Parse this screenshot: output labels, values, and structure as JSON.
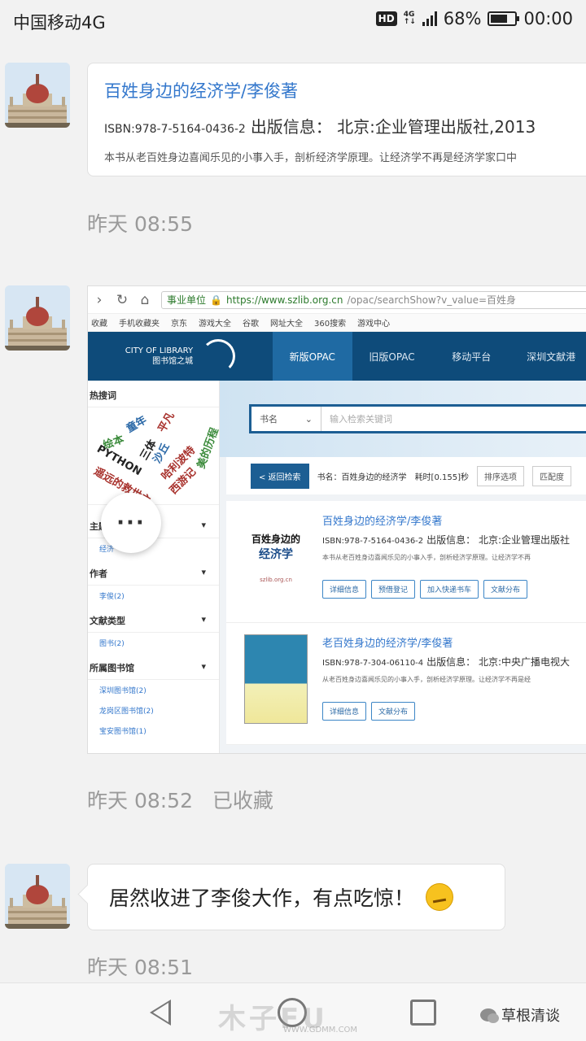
{
  "status_bar": {
    "carrier": "中国移动4G",
    "hd": "HD",
    "network_type": "4G",
    "battery": "68%",
    "clock": "00:00"
  },
  "messages": [
    {
      "card": {
        "title": "百姓身边的经济学/李俊著",
        "isbn": "ISBN:978-7-5164-0436-2",
        "publish": "出版信息： 北京:企业管理出版社,2013",
        "desc": "本书从老百姓身边喜闻乐见的小事入手，剖析经济学原理。让经济学不再是经济学家口中"
      },
      "time": "昨天 08:55"
    },
    {
      "time": "昨天 08:52",
      "status": "已收藏"
    },
    {
      "text": "居然收进了李俊大作，有点吃惊！",
      "time": "昨天 08:51"
    }
  ],
  "screenshot": {
    "url_prefix": "事业单位",
    "url": "https://www.szlib.org.cn",
    "url_rest": "/opac/searchShow?v_value=百姓身",
    "bookmarks": [
      "收藏",
      "手机收藏夹",
      "京东",
      "游戏大全",
      "谷歌",
      "网址大全",
      "360搜索",
      "游戏中心"
    ],
    "logo_line1": "CITY OF LIBRARY",
    "logo_line2": "图书馆之城",
    "nav": [
      "新版OPAC",
      "旧版OPAC",
      "移动平台",
      "深圳文献港"
    ],
    "sidebar": {
      "hot_title": "热搜词",
      "cloud": [
        "童年",
        "绘本",
        "三体",
        "PYTHON",
        "沙丘",
        "平凡",
        "哈利波特",
        "西游记",
        "美的历程",
        "遥远的救世主"
      ],
      "topic": "主题",
      "topic_item": "经济",
      "author": "作者",
      "author_item": "李俊(2)",
      "type": "文献类型",
      "type_item": "图书(2)",
      "library": "所属图书馆",
      "libraries": [
        "深圳图书馆(2)",
        "龙岗区图书馆(2)",
        "宝安图书馆(1)"
      ]
    },
    "search": {
      "select": "书名",
      "placeholder": "输入检索关键词"
    },
    "result_bar": {
      "back": "< 返回检索",
      "query": "书名：百姓身边的经济学",
      "timing": "耗时[0.155]秒",
      "sort": "排序选项",
      "match": "匹配度"
    },
    "results": [
      {
        "title": "百姓身边的经济学/李俊著",
        "isbn": "ISBN:978-7-5164-0436-2",
        "publish": "出版信息： 北京:企业管理出版社",
        "desc": "本书从老百姓身边喜闻乐见的小事入手，剖析经济学原理。让经济学不再",
        "cover_line1": "百姓身边的",
        "cover_line2": "经济学",
        "cover_site": "szlib.org.cn",
        "buttons": [
          "详细信息",
          "预借登记",
          "加入快递书车",
          "文献分布"
        ]
      },
      {
        "title": "老百姓身边的经济学/李俊著",
        "isbn": "ISBN:978-7-304-06110-4",
        "publish": "出版信息： 北京:中央广播电视大",
        "desc": "从老百姓身边喜闻乐见的小事入手，剖析经济学原理。让经济学不再是经",
        "buttons": [
          "详细信息",
          "文献分布"
        ]
      }
    ]
  },
  "bottom": {
    "watermark": "木子FU",
    "watermark_site": "WWW.GDMM.COM",
    "account": "草根清谈"
  }
}
